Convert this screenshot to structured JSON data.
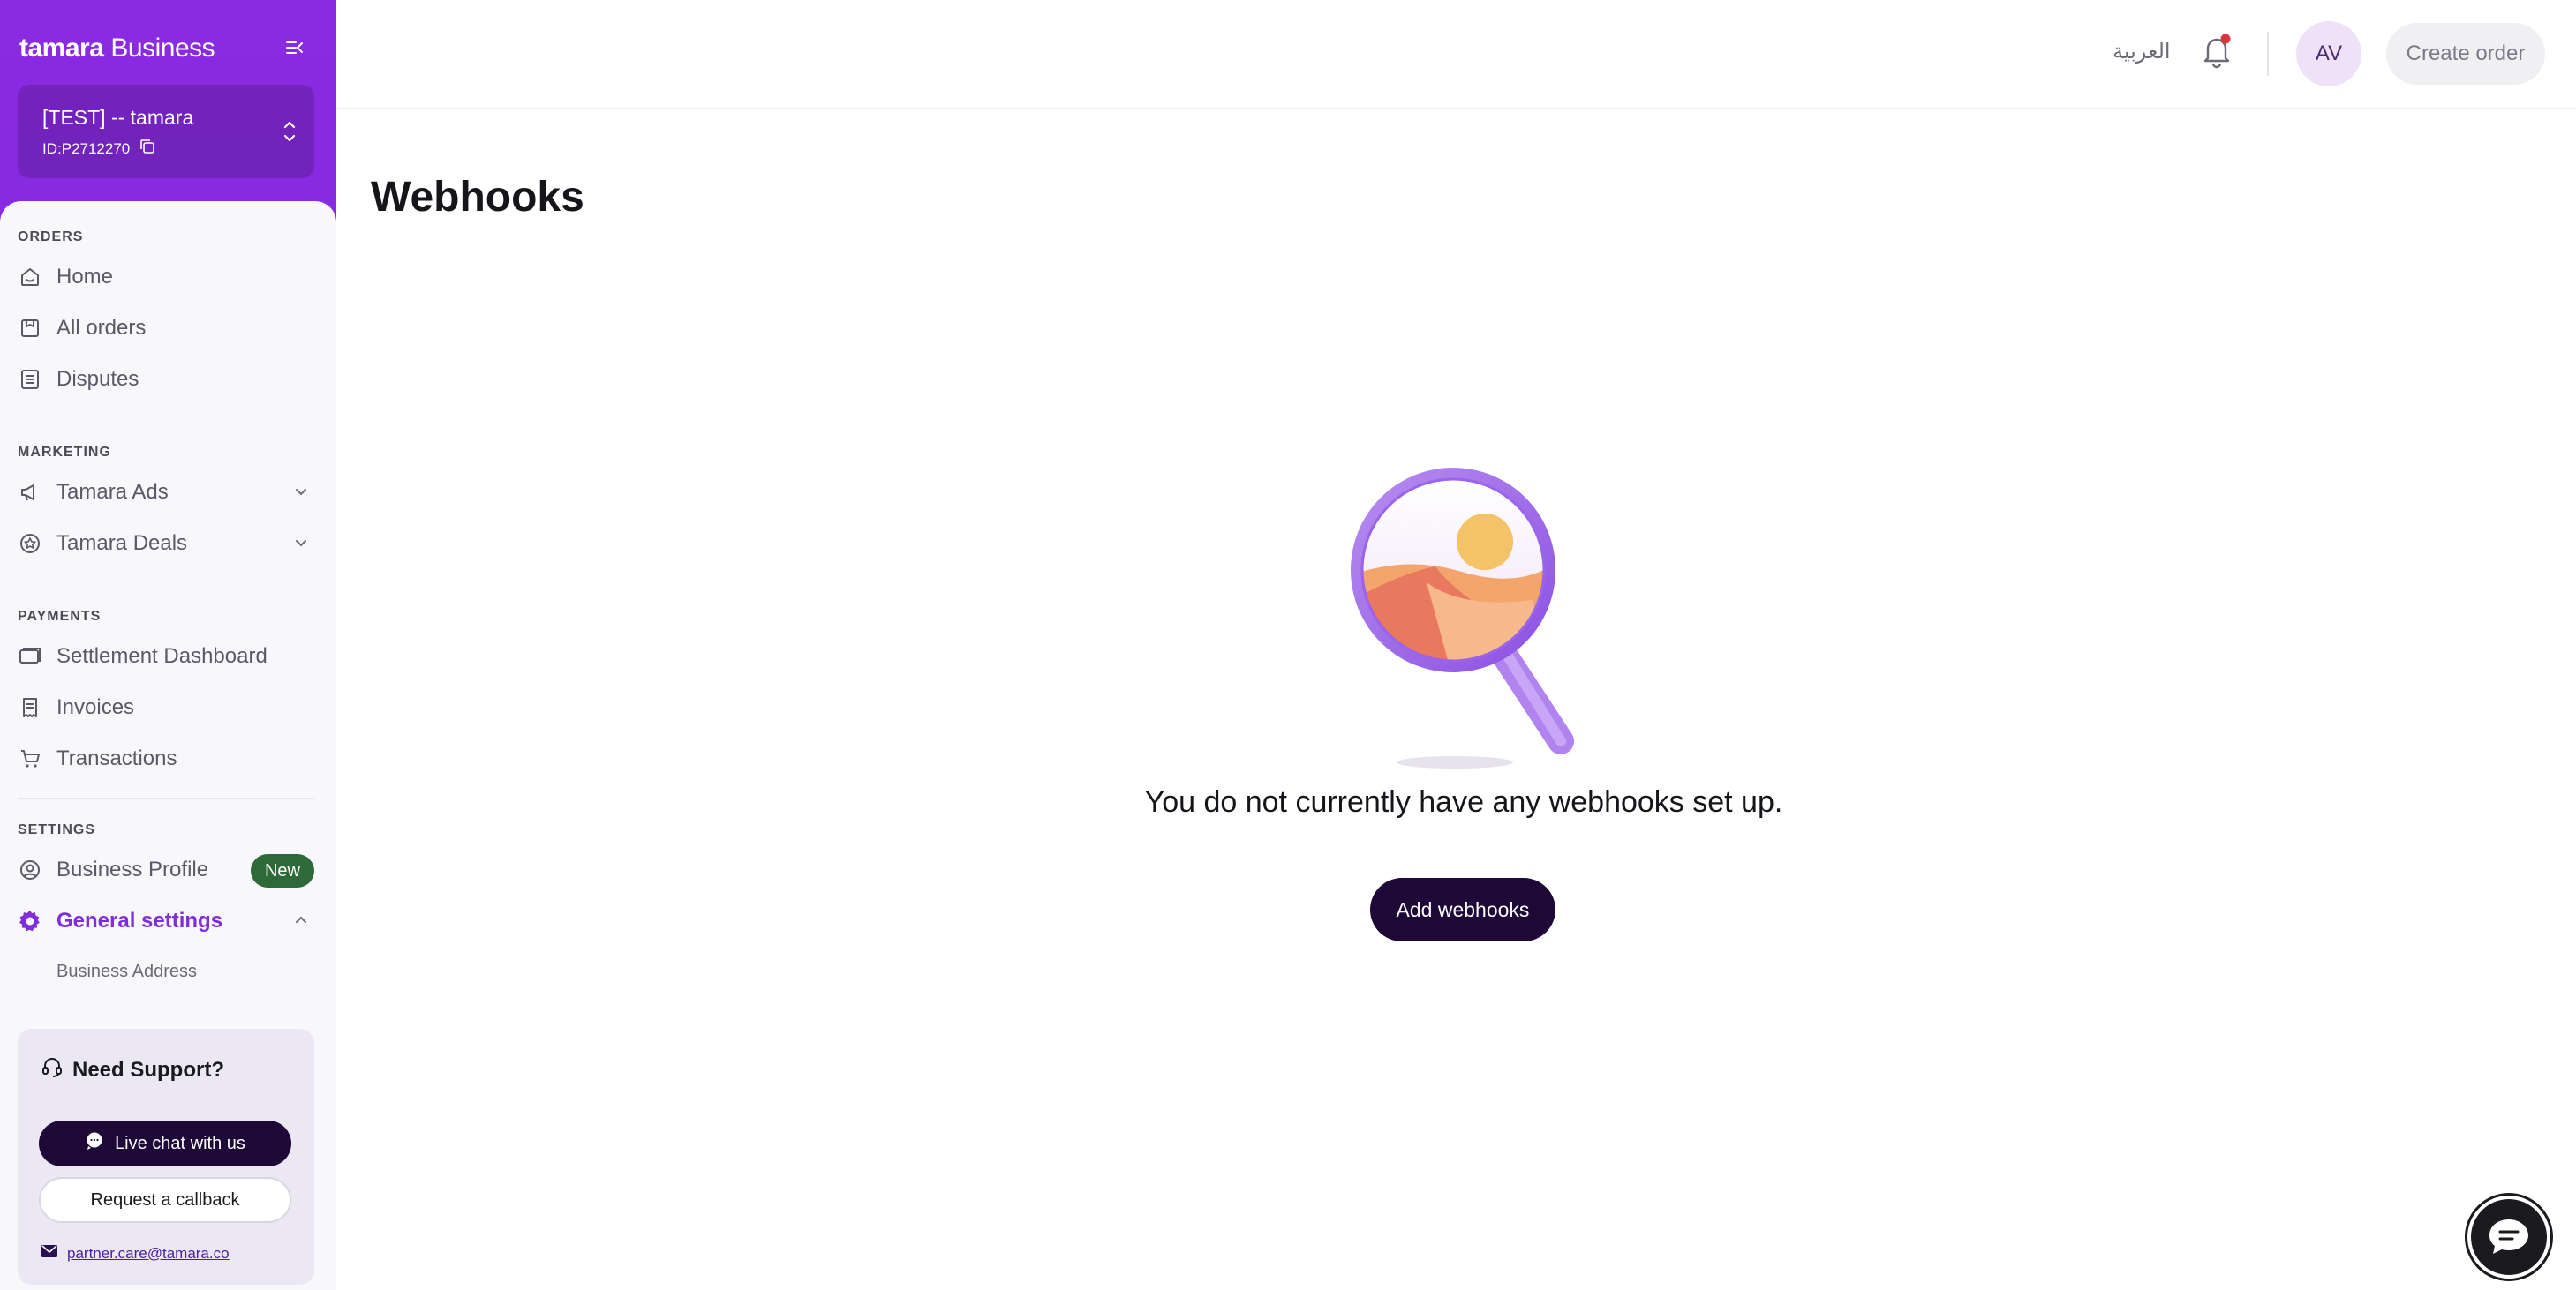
{
  "brand": {
    "part1": "tamara",
    "part2": "Business"
  },
  "account": {
    "name": "[TEST] -- tamara",
    "id_label": "ID:",
    "id_value": "P2712270"
  },
  "sidebar": {
    "sections": {
      "orders": "ORDERS",
      "marketing": "MARKETING",
      "payments": "PAYMENTS",
      "settings": "SETTINGS"
    },
    "items": {
      "home": "Home",
      "all_orders": "All orders",
      "disputes": "Disputes",
      "tamara_ads": "Tamara Ads",
      "tamara_deals": "Tamara Deals",
      "settlement_dashboard": "Settlement Dashboard",
      "invoices": "Invoices",
      "transactions": "Transactions",
      "business_profile": "Business Profile",
      "business_profile_badge": "New",
      "general_settings": "General settings",
      "business_address": "Business Address"
    },
    "accent_color": "#7f2fd9"
  },
  "support": {
    "title": "Need Support?",
    "live_chat": "Live chat with us",
    "callback": "Request a callback",
    "email": "partner.care@tamara.co"
  },
  "header": {
    "language": "العربية",
    "avatar_initials": "AV",
    "create_order": "Create order"
  },
  "main": {
    "title": "Webhooks",
    "empty_message": "You do not currently have any webhooks set up.",
    "add_button": "Add webhooks"
  },
  "icons": [
    "collapse-sidebar-icon",
    "copy-icon",
    "chevron-updown-icon",
    "home-icon",
    "orders-icon",
    "disputes-icon",
    "megaphone-icon",
    "star-badge-icon",
    "wallet-icon",
    "invoice-icon",
    "cart-icon",
    "user-circle-icon",
    "gear-icon",
    "chevron-down-icon",
    "chevron-up-icon",
    "headset-icon",
    "chat-bubble-icon",
    "mail-icon",
    "bell-icon",
    "magnifier-illustration",
    "chat-fab-icon"
  ]
}
